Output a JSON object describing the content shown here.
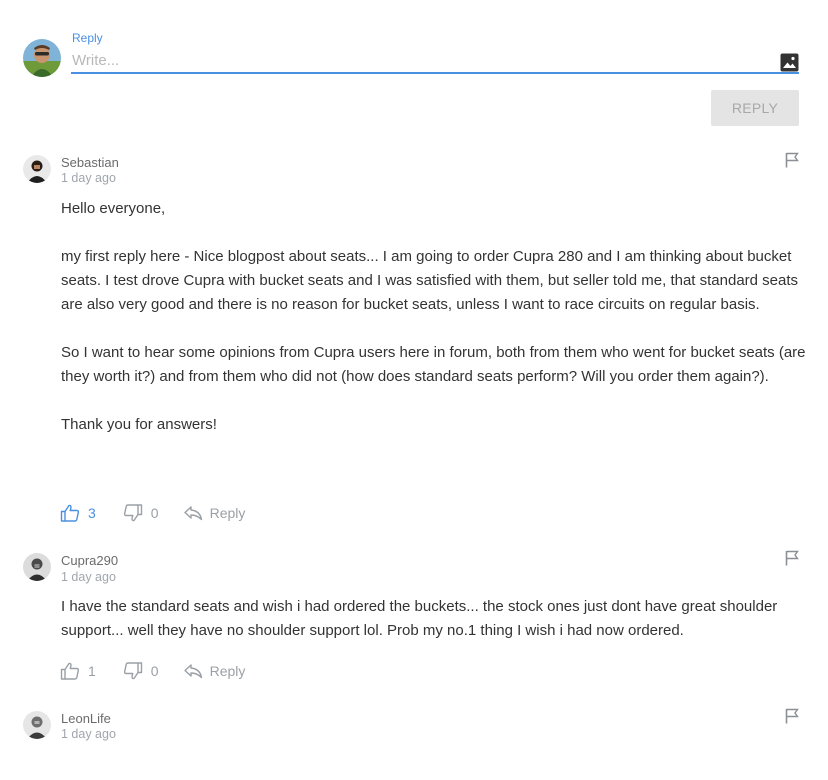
{
  "composer": {
    "label": "Reply",
    "placeholder": "Write...",
    "submit_label": "REPLY"
  },
  "comments": [
    {
      "author": "Sebastian",
      "time": "1 day ago",
      "paragraphs": [
        "Hello everyone,",
        "my first reply here - Nice blogpost about seats... I am going to order Cupra 280 and I am thinking about bucket seats. I test drove Cupra with bucket seats and I was satisfied with them, but seller told me, that standard seats are also very good and there is no reason for bucket seats, unless I want to race circuits on regular basis.",
        "So I want to hear some opinions from Cupra users here in forum, both from them who went for bucket seats (are they worth it?) and from them who did not (how does standard seats perform? Will you order them again?).",
        "Thank you for answers!"
      ],
      "likes": "3",
      "dislikes": "0",
      "reply_label": "Reply"
    },
    {
      "author": "Cupra290",
      "time": "1 day ago",
      "paragraphs": [
        "I have the standard seats and wish i had ordered the buckets... the stock ones just dont have great shoulder support... well they have no shoulder support lol. Prob my no.1 thing I wish i had now ordered."
      ],
      "likes": "1",
      "dislikes": "0",
      "reply_label": "Reply"
    },
    {
      "author": "LeonLife",
      "time": "1 day ago"
    }
  ],
  "colors": {
    "accent": "#4a90e2",
    "muted": "#9aa0a6",
    "button_bg": "#e4e4e4"
  }
}
